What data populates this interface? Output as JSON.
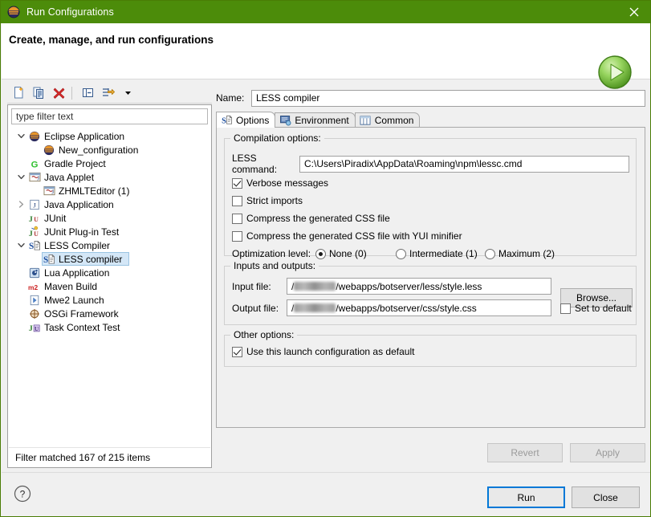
{
  "window": {
    "title": "Run Configurations",
    "icon": "eclipse-icon",
    "close_label": "×",
    "accent_green": "#4c8c0a"
  },
  "header": {
    "title": "Create, manage, and run configurations",
    "icon": "run-play-icon"
  },
  "tree_toolbar": {
    "buttons": [
      {
        "name": "new-configuration-icon",
        "tip": "New launch configuration"
      },
      {
        "name": "duplicate-configuration-icon",
        "tip": "Duplicate"
      },
      {
        "name": "delete-configuration-icon",
        "tip": "Delete"
      },
      {
        "name": "collapse-all-icon",
        "tip": "Collapse All"
      },
      {
        "name": "filter-icon",
        "tip": "Filter launch configurations"
      },
      {
        "name": "chevron-down-icon",
        "tip": "Menu"
      }
    ]
  },
  "filter": {
    "placeholder": "type filter text",
    "value": "",
    "status": "Filter matched 167 of 215 items"
  },
  "tree": {
    "items": [
      {
        "label": "Eclipse Application",
        "icon": "eclipse-icon",
        "indent": 0,
        "twisty": "expanded",
        "selected": false
      },
      {
        "label": "New_configuration",
        "icon": "eclipse-icon",
        "indent": 1,
        "twisty": "none",
        "selected": false
      },
      {
        "label": "Gradle Project",
        "icon": "gradle-icon",
        "indent": 0,
        "twisty": "none",
        "selected": false
      },
      {
        "label": "Java Applet",
        "icon": "java-applet-icon",
        "indent": 0,
        "twisty": "expanded",
        "selected": false
      },
      {
        "label": "ZHMLTEditor (1)",
        "icon": "java-applet-icon",
        "indent": 1,
        "twisty": "none",
        "selected": false
      },
      {
        "label": "Java Application",
        "icon": "java-app-icon",
        "indent": 0,
        "twisty": "collapsed",
        "selected": false
      },
      {
        "label": "JUnit",
        "icon": "junit-icon",
        "indent": 0,
        "twisty": "none",
        "selected": false
      },
      {
        "label": "JUnit Plug-in Test",
        "icon": "junit-plugin-icon",
        "indent": 0,
        "twisty": "none",
        "selected": false
      },
      {
        "label": "LESS Compiler",
        "icon": "less-icon",
        "indent": 0,
        "twisty": "expanded",
        "selected": false
      },
      {
        "label": "LESS compiler",
        "icon": "less-icon",
        "indent": 1,
        "twisty": "none",
        "selected": true
      },
      {
        "label": "Lua Application",
        "icon": "lua-icon",
        "indent": 0,
        "twisty": "none",
        "selected": false
      },
      {
        "label": "Maven Build",
        "icon": "maven-icon",
        "indent": 0,
        "twisty": "none",
        "selected": false
      },
      {
        "label": "Mwe2 Launch",
        "icon": "mwe2-icon",
        "indent": 0,
        "twisty": "none",
        "selected": false
      },
      {
        "label": "OSGi Framework",
        "icon": "osgi-icon",
        "indent": 0,
        "twisty": "none",
        "selected": false
      },
      {
        "label": "Task Context Test",
        "icon": "task-context-icon",
        "indent": 0,
        "twisty": "none",
        "selected": false
      }
    ]
  },
  "name_field": {
    "label": "Name:",
    "value": "LESS compiler",
    "placeholder": ""
  },
  "tabs": [
    {
      "label": "Options",
      "icon": "less-icon",
      "active": true
    },
    {
      "label": "Environment",
      "icon": "environment-icon",
      "active": false
    },
    {
      "label": "Common",
      "icon": "common-icon",
      "active": false
    }
  ],
  "options_tab": {
    "compilation_group": {
      "title": "Compilation options:",
      "less_command_label": "LESS command:",
      "less_command_value": "C:\\Users\\Piradix\\AppData\\Roaming\\npm\\lessc.cmd",
      "checkboxes": [
        {
          "label": "Verbose messages",
          "checked": true
        },
        {
          "label": "Strict imports",
          "checked": false
        },
        {
          "label": "Compress the generated CSS file",
          "checked": false
        },
        {
          "label": "Compress the generated CSS file with YUI minifier",
          "checked": false
        }
      ],
      "optimization_label": "Optimization level:",
      "optimization_options": [
        {
          "label": "None (0)",
          "selected": true
        },
        {
          "label": "Intermediate (1)",
          "selected": false
        },
        {
          "label": "Maximum (2)",
          "selected": false
        }
      ]
    },
    "io_group": {
      "title": "Inputs and outputs:",
      "input_file_label": "Input file:",
      "input_file_prefix": "/",
      "input_file_redacted": true,
      "input_file_suffix": "/webapps/botserver/less/style.less",
      "output_file_label": "Output file:",
      "output_file_prefix": "/",
      "output_file_redacted": true,
      "output_file_suffix": "/webapps/botserver/css/style.css",
      "browse_label": "Browse...",
      "set_to_default_label": "Set to default",
      "set_to_default_checked": false
    },
    "other_group": {
      "title": "Other options:",
      "use_as_default_label": "Use this launch configuration as default",
      "use_as_default_checked": true
    }
  },
  "buttons": {
    "revert": {
      "label": "Revert",
      "enabled": false
    },
    "apply": {
      "label": "Apply",
      "enabled": false
    },
    "run": {
      "label": "Run",
      "default": true
    },
    "close": {
      "label": "Close",
      "default": false
    },
    "help": {
      "name": "help-icon",
      "label": "?"
    }
  }
}
